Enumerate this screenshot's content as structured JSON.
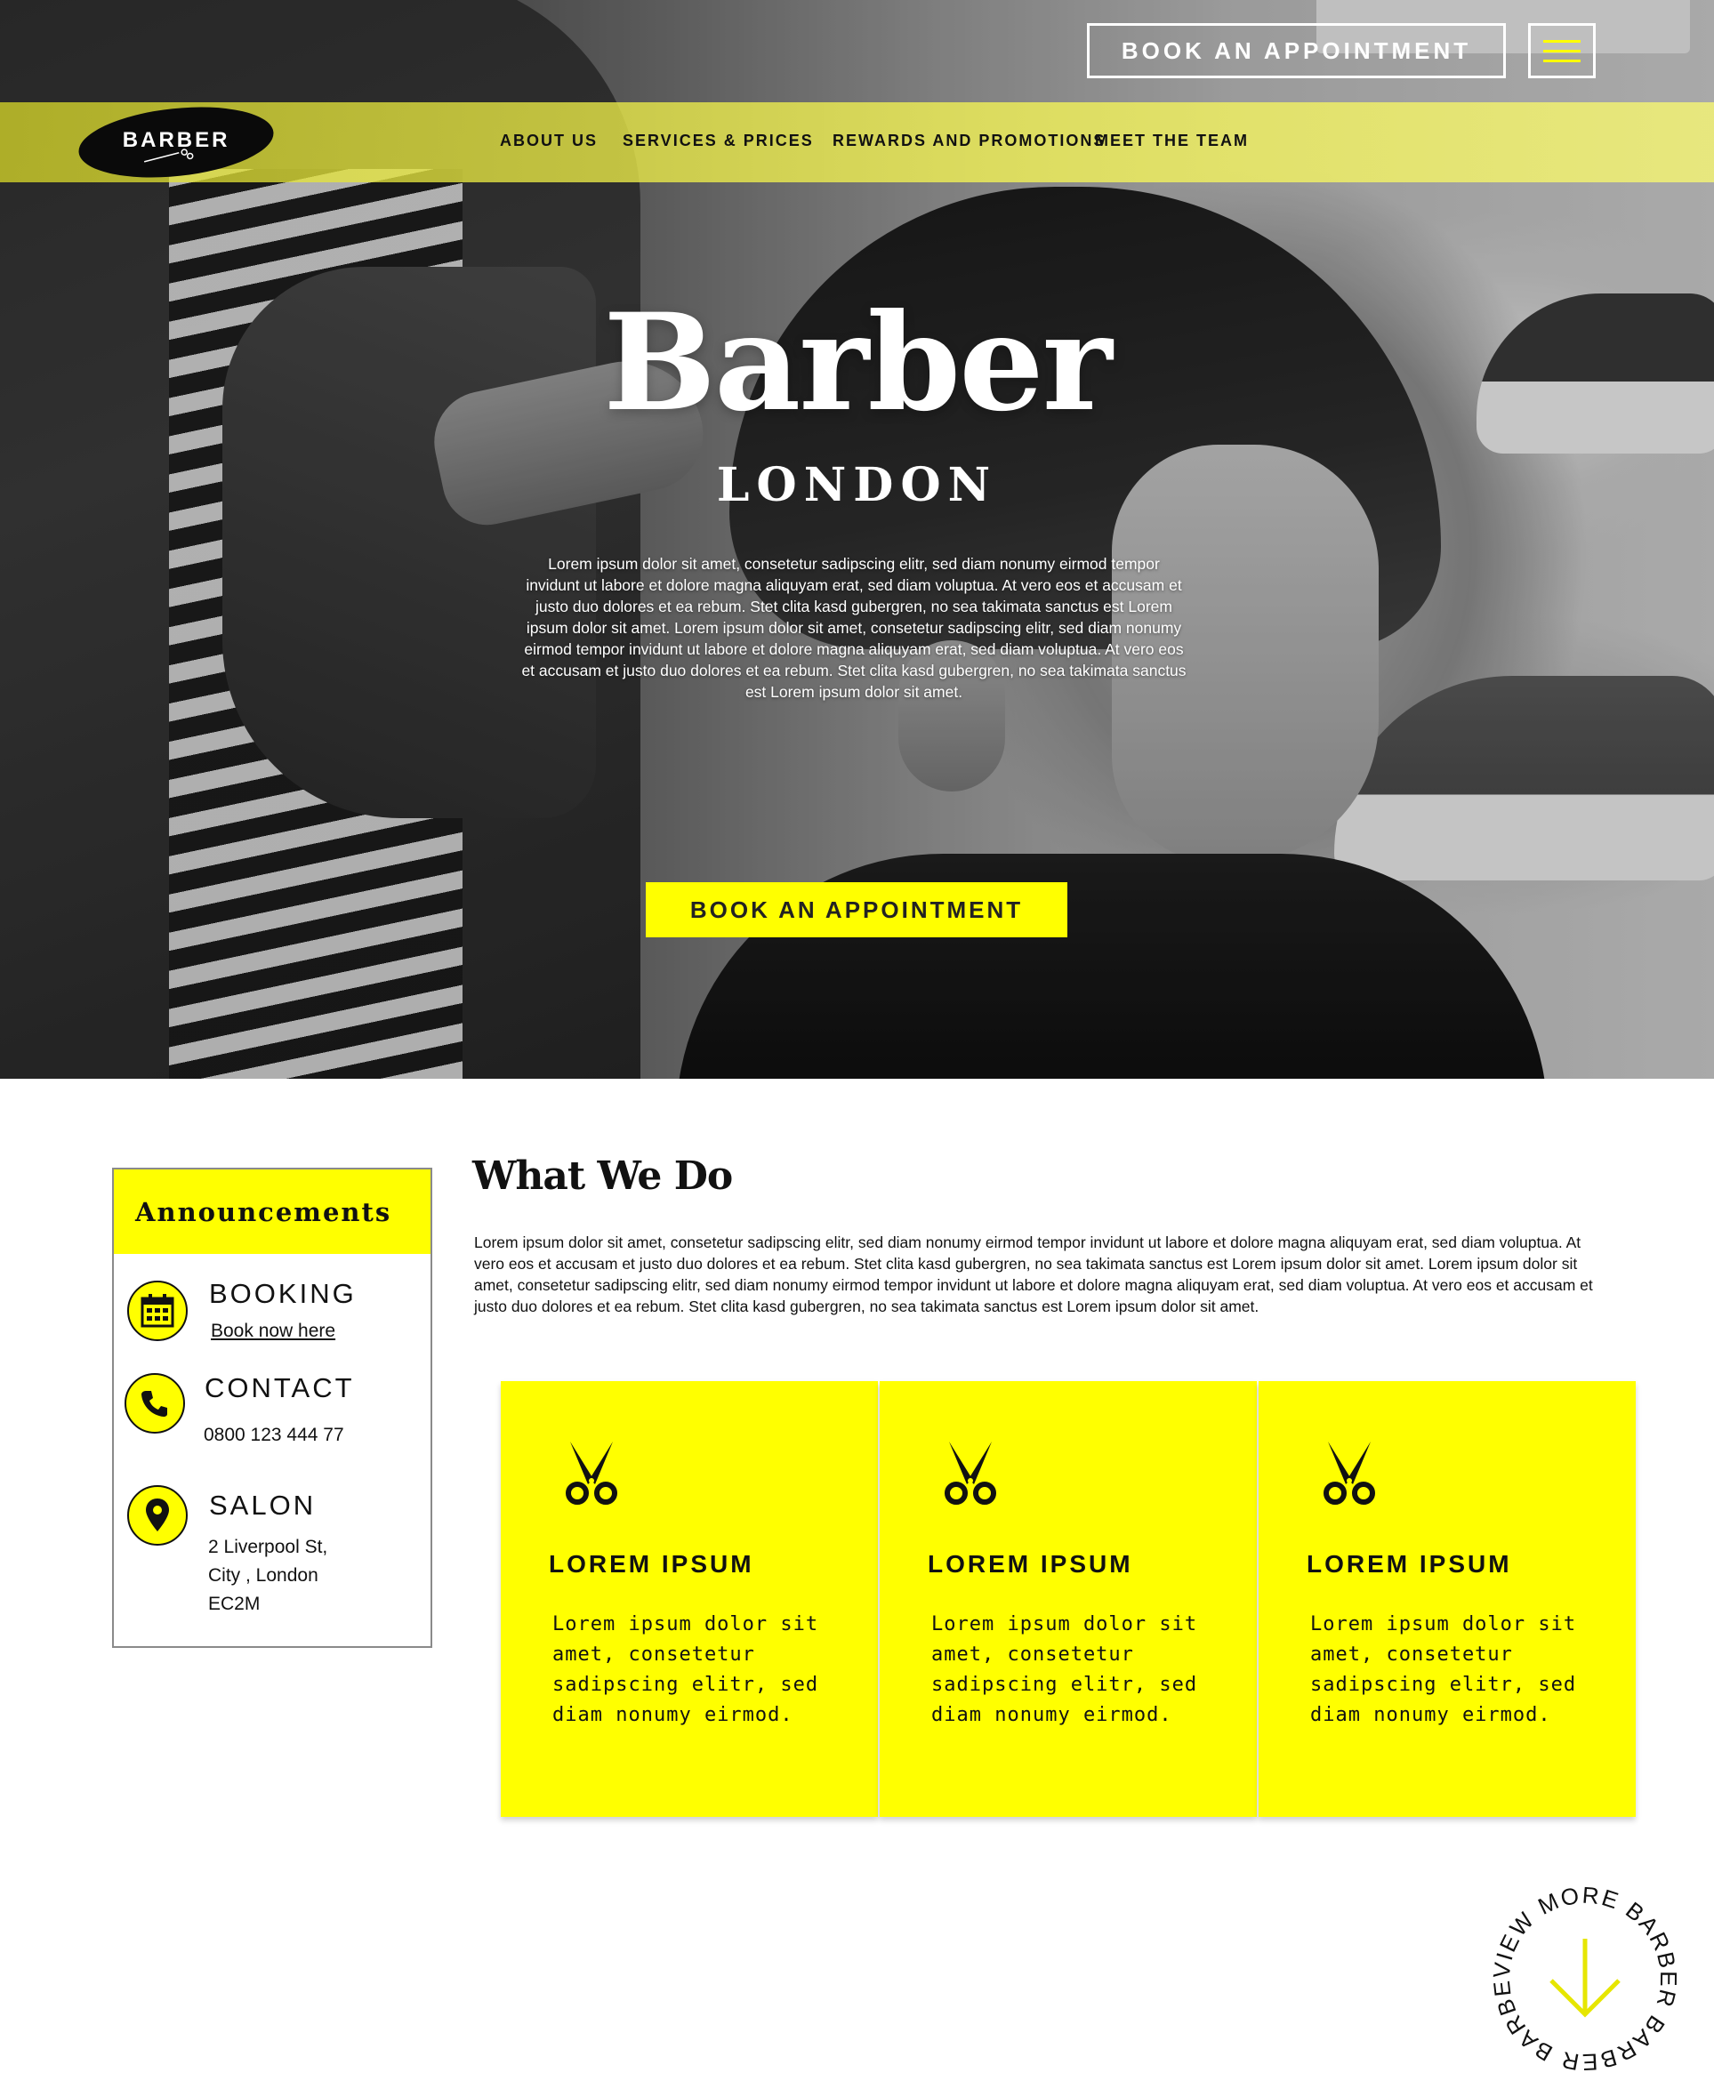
{
  "header": {
    "top_book_label": "BOOK AN APPOINTMENT",
    "logo_text": "BARBER",
    "nav": [
      "ABOUT US",
      "SERVICES & PRICES",
      "REWARDS AND PROMOTIONS",
      "MEET THE TEAM"
    ]
  },
  "hero": {
    "title": "Barber",
    "subtitle": "LONDON",
    "paragraph": "Lorem ipsum dolor sit amet, consetetur sadipscing elitr, sed diam nonumy eirmod tempor invidunt ut labore et dolore magna aliquyam erat, sed diam voluptua. At vero eos et accusam et justo duo dolores et ea rebum. Stet clita kasd gubergren, no sea takimata sanctus est Lorem ipsum dolor sit amet. Lorem ipsum dolor sit amet, consetetur sadipscing elitr, sed diam nonumy eirmod tempor invidunt ut labore et dolore magna aliquyam erat, sed diam voluptua. At vero eos et accusam et justo duo dolores et ea rebum. Stet clita kasd gubergren, no sea takimata sanctus est Lorem ipsum dolor sit amet.",
    "book_label": "BOOK AN APPOINTMENT"
  },
  "announcements": {
    "title": "Announcements",
    "booking": {
      "label": "BOOKING",
      "link": "Book now here"
    },
    "contact": {
      "label": "CONTACT",
      "phone": "0800 123 444 77"
    },
    "salon": {
      "label": "SALON",
      "address_line1": "2 Liverpool St,",
      "address_line2": "City , London",
      "address_line3": "EC2M"
    }
  },
  "what_we_do": {
    "title": "What We Do",
    "paragraph": "Lorem ipsum dolor sit amet, consetetur sadipscing elitr, sed diam nonumy eirmod tempor invidunt ut labore et dolore magna aliquyam erat, sed diam voluptua. At vero eos et accusam et justo duo dolores et ea rebum. Stet clita kasd gubergren, no sea takimata sanctus est Lorem ipsum dolor sit amet. Lorem ipsum dolor sit amet, consetetur sadipscing elitr, sed diam nonumy eirmod tempor invidunt ut labore et dolore magna aliquyam erat, sed diam voluptua. At vero eos et accusam et justo duo dolores et ea rebum. Stet clita kasd gubergren, no sea takimata sanctus est Lorem ipsum dolor sit amet.",
    "cards": [
      {
        "icon": "scissors-icon",
        "title": "LOREM IPSUM",
        "text": "Lorem ipsum dolor sit amet, consetetur sadipscing elitr, sed diam nonumy eirmod."
      },
      {
        "icon": "scissors-icon",
        "title": "LOREM IPSUM",
        "text": "Lorem ipsum dolor sit amet, consetetur sadipscing elitr, sed diam nonumy eirmod."
      },
      {
        "icon": "scissors-icon",
        "title": "LOREM IPSUM",
        "text": "Lorem ipsum dolor sit amet, consetetur sadipscing elitr, sed diam nonumy eirmod."
      }
    ]
  },
  "view_more": {
    "top_text": "VIEW MORE BARBER BARBER BARBER",
    "icon": "arrow-down-icon"
  },
  "colors": {
    "accent": "#ffff00",
    "text": "#111111",
    "white": "#ffffff"
  }
}
